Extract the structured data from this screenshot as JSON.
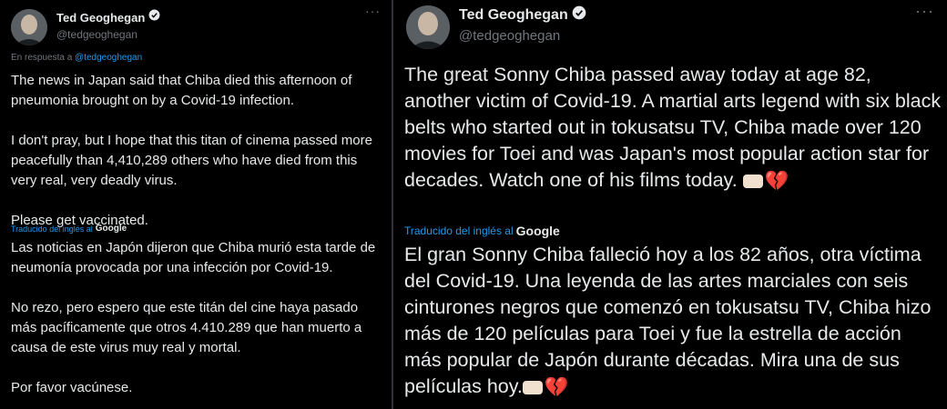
{
  "left": {
    "author": {
      "name": "Ted Geoghegan",
      "handle": "@tedgeoghegan"
    },
    "reply_prefix": "En respuesta a ",
    "reply_handle": "@tedgeoghegan",
    "original": "The news in Japan said that Chiba died this afternoon of pneumonia brought on by a Covid-19 infection.\n\nI don't pray, but I hope that this titan of cinema passed more peacefully than 4,410,289 others who have died from this very real, very deadly virus.\n\nPlease get vaccinated.",
    "translated_label": "Traducido del inglés al",
    "translator": "Google",
    "translation": "Las noticias en Japón dijeron que Chiba murió esta tarde de neumonía provocada por una infección por Covid-19.\n\n No rezo, pero espero que este titán del cine haya pasado más pacíficamente que otros 4.410.289 que han muerto a causa de este virus muy real y mortal.\n\n Por favor vacúnese."
  },
  "right": {
    "author": {
      "name": "Ted Geoghegan",
      "handle": "@tedgeoghegan"
    },
    "original": "The great Sonny Chiba passed away today at age 82, another victim of Covid-19. A martial arts legend with six black belts who started out in tokusatsu TV, Chiba made over 120 movies for Toei and was Japan's most popular action star for decades. Watch one of his films today.",
    "translated_label": "Traducido del inglés al",
    "translator": "Google",
    "translation": "El gran Sonny Chiba falleció hoy a los 82 años, otra víctima del Covid-19. Una leyenda de las artes marciales con seis cinturones negros que comenzó en tokusatsu TV, Chiba hizo más de 120 películas para Toei y fue la estrella de acción más popular de Japón durante décadas. Mira una de sus películas hoy."
  },
  "more_label": "···",
  "emoji": {
    "heart": "💔"
  },
  "colors": {
    "link": "#1d9bf0",
    "muted": "#71767b",
    "text": "#e7e9ea",
    "background": "#000000"
  },
  "icons": [
    "verified-badge-icon",
    "more-options-icon",
    "fist-emoji-icon",
    "broken-heart-emoji-icon"
  ]
}
